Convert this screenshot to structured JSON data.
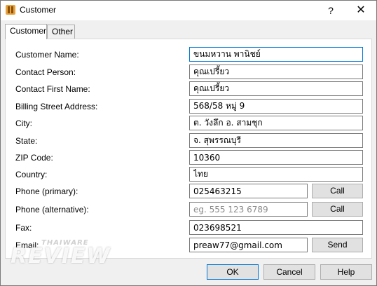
{
  "window": {
    "title": "Customer",
    "help_glyph": "?",
    "close_glyph": "✕"
  },
  "tabs": [
    {
      "label": "Customer",
      "active": true
    },
    {
      "label": "Other",
      "active": false
    }
  ],
  "fields": {
    "customer_name": {
      "label": "Customer Name:",
      "value": "ขนมหวาน พานิชย์"
    },
    "contact_person": {
      "label": "Contact Person:",
      "value": "คุณเปรี้ยว"
    },
    "contact_first_name": {
      "label": "Contact First Name:",
      "value": "คุณเปรี้ยว"
    },
    "billing_street": {
      "label": "Billing Street Address:",
      "value": "568/58 หมู่ 9"
    },
    "city": {
      "label": "City:",
      "value": "ต. วังลึก อ. สามชุก"
    },
    "state": {
      "label": "State:",
      "value": "จ. สุพรรณบุรี"
    },
    "zip": {
      "label": "ZIP Code:",
      "value": "10360"
    },
    "country": {
      "label": "Country:",
      "value": "ไทย"
    },
    "phone_primary": {
      "label": "Phone (primary):",
      "value": "025463215",
      "button": "Call"
    },
    "phone_alternative": {
      "label": "Phone (alternative):",
      "value": "",
      "placeholder": "eg. 555 123 6789",
      "button": "Call"
    },
    "fax": {
      "label": "Fax:",
      "value": "023698521"
    },
    "email": {
      "label": "Email:",
      "value": "preaw77@gmail.com",
      "button": "Send"
    }
  },
  "footer": {
    "ok": "OK",
    "cancel": "Cancel",
    "help": "Help"
  },
  "watermark": {
    "top": "THAIWARE",
    "main": "REVIEW"
  }
}
